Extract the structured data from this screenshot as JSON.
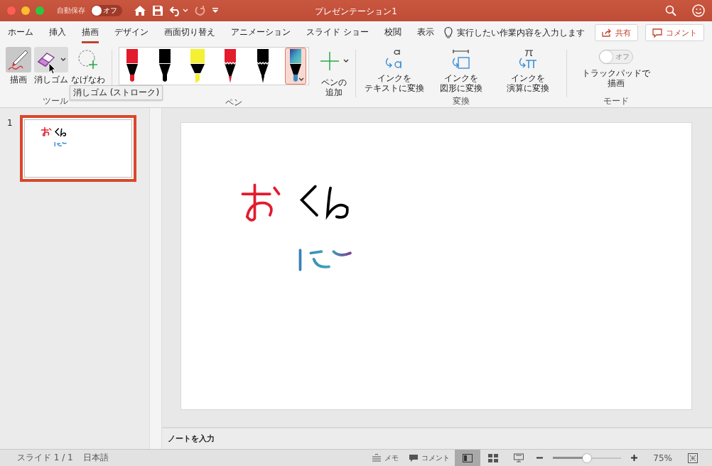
{
  "window": {
    "title": "プレゼンテーション1",
    "autosave": {
      "label": "自動保存",
      "on": false,
      "state_label": "オフ"
    }
  },
  "tabs": [
    {
      "label": "ホーム",
      "selected": false
    },
    {
      "label": "挿入",
      "selected": false
    },
    {
      "label": "描画",
      "selected": true
    },
    {
      "label": "デザイン",
      "selected": false
    },
    {
      "label": "画面切り替え",
      "selected": false
    },
    {
      "label": "アニメーション",
      "selected": false
    },
    {
      "label": "スライド ショー",
      "selected": false
    },
    {
      "label": "校閲",
      "selected": false
    },
    {
      "label": "表示",
      "selected": false
    }
  ],
  "tell_me": "実行したい作業内容を入力します",
  "share": "共有",
  "comments": "コメント",
  "tools": {
    "label": "ツール",
    "items": [
      {
        "kind": "draw",
        "label": "描画",
        "selected": true
      },
      {
        "kind": "eraser",
        "label": "消しゴム",
        "selected": false,
        "hovered": true
      },
      {
        "kind": "lasso",
        "label": "なげなわ",
        "selected": false
      }
    ]
  },
  "tooltip": "消しゴム (ストローク)",
  "pens": {
    "label": "ペン",
    "items": [
      {
        "kind": "pen",
        "color": "#e31b2d",
        "selected": false
      },
      {
        "kind": "pen",
        "color": "#000000",
        "selected": false
      },
      {
        "kind": "highlighter",
        "color": "#f5f032",
        "selected": false
      },
      {
        "kind": "pencil",
        "color": "#e31b2d",
        "selected": false
      },
      {
        "kind": "pencil",
        "color": "#000000",
        "selected": false
      },
      {
        "kind": "galaxy",
        "color": "#3a8cc0",
        "selected": true
      }
    ],
    "add_lines": [
      "ペンの",
      "追加"
    ]
  },
  "convert": {
    "label": "変換",
    "items": [
      {
        "kind": "text",
        "lines": [
          "インクを",
          "テキストに変換"
        ]
      },
      {
        "kind": "shape",
        "lines": [
          "インクを",
          "図形に変換"
        ]
      },
      {
        "kind": "math",
        "lines": [
          "インクを",
          "演算に変換"
        ]
      }
    ]
  },
  "mode": {
    "label": "モード",
    "trackpad": {
      "on": false,
      "state_label": "オフ",
      "lines": [
        "トラックパッドで",
        "描画"
      ]
    }
  },
  "slides": [
    {
      "number": "1",
      "selected": true
    }
  ],
  "notes_placeholder": "ノートを入力",
  "status_bar": {
    "slide": "スライド 1 / 1",
    "language": "日本語",
    "notes": "メモ",
    "comments": "コメント",
    "views": [
      {
        "kind": "normal",
        "selected": true
      },
      {
        "kind": "sorter",
        "selected": false
      },
      {
        "kind": "reading",
        "selected": false
      }
    ],
    "zoom": {
      "level": 0.5,
      "reading": "75%"
    }
  }
}
